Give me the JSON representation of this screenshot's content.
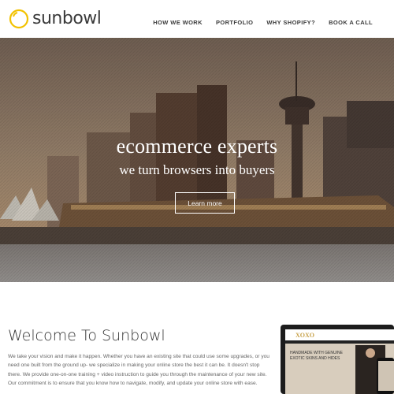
{
  "header": {
    "logo_text": "sunbowl",
    "nav": [
      "HOW WE WORK",
      "PORTFOLIO",
      "WHY SHOPIFY?",
      "BOOK A CALL"
    ]
  },
  "hero": {
    "title": "ecommerce experts",
    "subtitle": "we turn browsers into buyers",
    "button_label": "Learn more"
  },
  "welcome": {
    "title": "Welcome To Sunbowl",
    "body": "We take your vision and make it happen. Whether you have an existing site that could use some upgrades, or you need one built from the ground up- we specialize in making your online store the best it can be. It doesn't stop there. We provide one-on-one training + video instruction to guide you through the maintenance of your new site. Our commitment is to ensure that you know how to navigate, modify, and update your online store with ease."
  },
  "mockup": {
    "brand": "XOXO",
    "headline_line1": "HANDMADE WITH GENUINE",
    "headline_line2": "EXOTIC SKINS AND HIDES"
  },
  "colors": {
    "logo_accent": "#f2c200",
    "text_dark": "#333333",
    "hero_overlay": "#6e5a48"
  }
}
